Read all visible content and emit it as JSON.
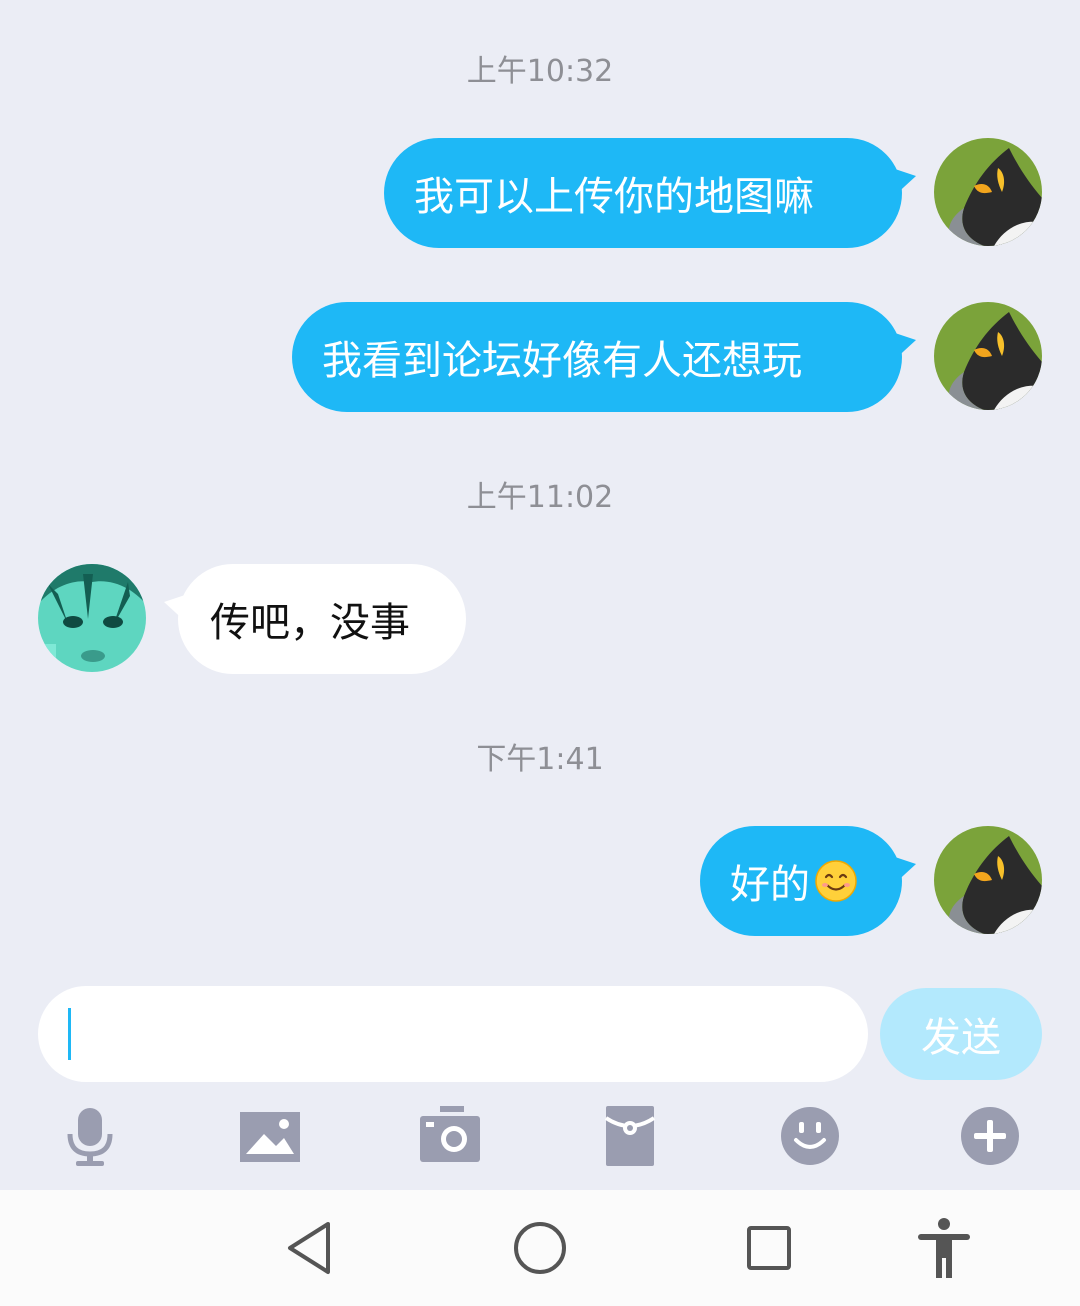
{
  "messages": [
    {
      "type": "timestamp",
      "text": "上午10:32"
    },
    {
      "type": "outgoing",
      "text": "我可以上传你的地图嘛"
    },
    {
      "type": "outgoing",
      "text": "我看到论坛好像有人还想玩"
    },
    {
      "type": "timestamp",
      "text": "上午11:02"
    },
    {
      "type": "incoming",
      "text": "传吧，没事"
    },
    {
      "type": "timestamp",
      "text": "下午1:41"
    },
    {
      "type": "outgoing",
      "text": "好的",
      "emoji": "smiling-face-emoji"
    }
  ],
  "composer": {
    "input_value": "",
    "send_label": "发送"
  },
  "toolbar": {
    "icons": [
      "microphone-icon",
      "image-icon",
      "camera-icon",
      "red-packet-icon",
      "emoji-icon",
      "plus-icon"
    ]
  },
  "nav": {
    "icons": [
      "back-icon",
      "home-icon",
      "recents-icon",
      "accessibility-icon"
    ]
  },
  "colors": {
    "background": "#ebedf5",
    "outgoing_bubble": "#1eb8f6",
    "incoming_bubble": "#ffffff",
    "timestamp_text": "#8e8f95",
    "send_button_disabled": "#b3e9fd",
    "toolbar_icon": "#9a9db0"
  }
}
